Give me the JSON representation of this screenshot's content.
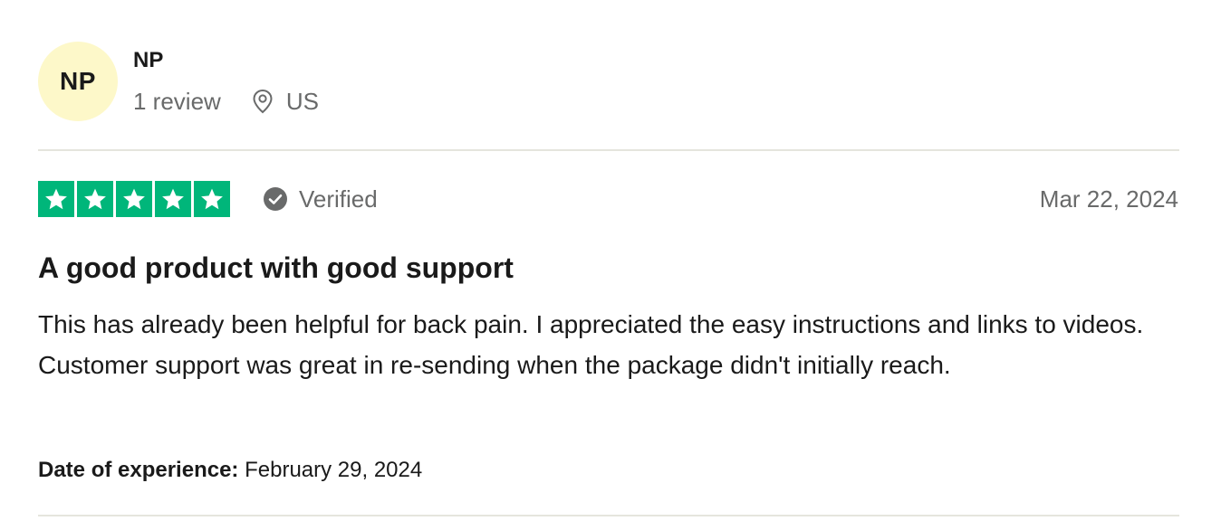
{
  "reviewer": {
    "initials": "NP",
    "name": "NP",
    "review_count": "1 review",
    "location": "US"
  },
  "review": {
    "rating": 5,
    "rating_max": 5,
    "star_color": "#00b67a",
    "verified_label": "Verified",
    "date": "Mar 22, 2024",
    "title": "A good product with good support",
    "body": "This has already been helpful for back pain. I appreciated the easy instructions and links to videos. Customer support was great in re-sending when the package didn't initially reach.",
    "experience_label": "Date of experience:",
    "experience_date": "February 29, 2024"
  },
  "icons": {
    "location": "map-pin-icon",
    "verified": "check-circle-icon",
    "star": "star-icon"
  },
  "colors": {
    "avatar_bg": "#fdf8c9",
    "muted_text": "#696a6a",
    "divider": "#e5e5dd"
  }
}
